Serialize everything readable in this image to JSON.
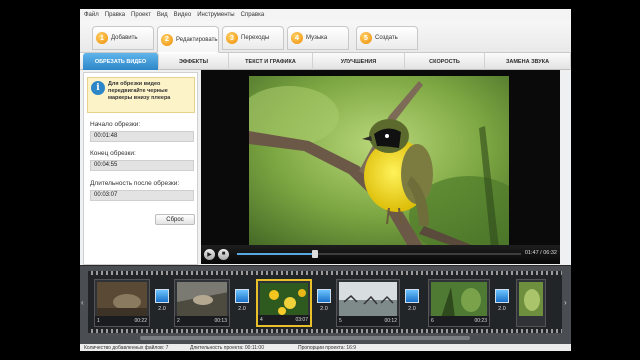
{
  "menubar": [
    "Файл",
    "Правка",
    "Проект",
    "Вид",
    "Видео",
    "Инструменты",
    "Справка"
  ],
  "steps": [
    {
      "num": "1",
      "label": "Добавить"
    },
    {
      "num": "2",
      "label": "Редактировать"
    },
    {
      "num": "3",
      "label": "Переходы"
    },
    {
      "num": "4",
      "label": "Музыка"
    },
    {
      "num": "5",
      "label": "Создать"
    }
  ],
  "subtabs": [
    "ОБРЕЗАТЬ ВИДЕО",
    "ЭФФЕКТЫ",
    "ТЕКСТ И ГРАФИКА",
    "УЛУЧШЕНИЯ",
    "СКОРОСТЬ",
    "ЗАМЕНА ЗВУКА"
  ],
  "info": {
    "icon": "info-icon",
    "glyph": "i",
    "text": "Для обрезки видео передвигайте черные маркеры внизу плеера"
  },
  "trim": {
    "start_label": "Начало обрезки:",
    "start_value": "00:01:48",
    "end_label": "Конец обрезки:",
    "end_value": "00:04:55",
    "duration_label": "Длительность после обрезки:",
    "duration_value": "00:03:07",
    "reset_label": "Сброс"
  },
  "player": {
    "timecode": "01:47 / 06:32",
    "play_icon": "play-icon",
    "stop_icon": "stop-icon",
    "progress": 0.275
  },
  "timeline": {
    "clips": [
      {
        "index": "1",
        "duration": "00:22"
      },
      {
        "index": "2",
        "duration": "00:13"
      },
      {
        "index": "4",
        "duration": "03:07"
      },
      {
        "index": "5",
        "duration": "00:12"
      },
      {
        "index": "6",
        "duration": "00:23"
      }
    ],
    "transitions": [
      "2.0",
      "2.0",
      "2.0",
      "2.0",
      "2.0"
    ]
  },
  "status": {
    "files": "Количество добавленных файлов: 7",
    "duration": "Длительность проекта: 00:11:00",
    "aspect": "Пропорции проекта: 16:9"
  },
  "colors": {
    "accent": "#2d86c8",
    "step_badge": "#f08a00",
    "selected_clip": "#e8c12a"
  }
}
